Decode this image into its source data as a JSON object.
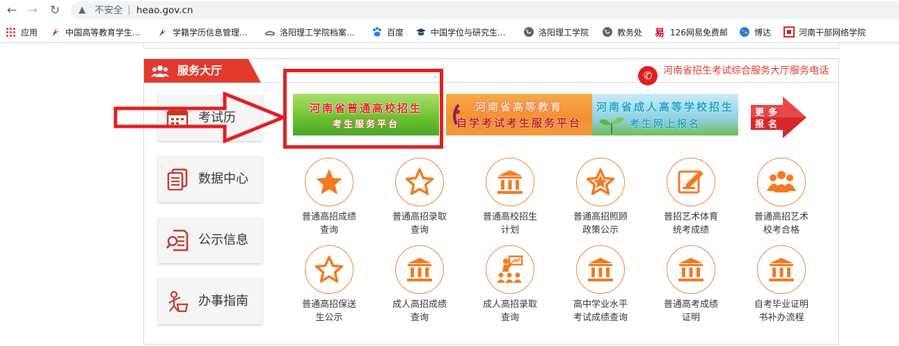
{
  "browser": {
    "insecure_label": "不安全",
    "url": "heao.gov.cn",
    "bookmarks": [
      {
        "label": "应用",
        "icon": "apps-grid-icon"
      },
      {
        "label": "中国高等教育学生...",
        "icon": "chsi-logo-icon"
      },
      {
        "label": "学籍学历信息管理...",
        "icon": "chsi-logo-icon"
      },
      {
        "label": "洛阳理工学院档案...",
        "icon": "archive-logo-icon"
      },
      {
        "label": "百度",
        "icon": "baidu-paw-icon"
      },
      {
        "label": "中国学位与研究生...",
        "icon": "graduation-cap-icon"
      },
      {
        "label": "洛阳理工学院",
        "icon": "globe-icon"
      },
      {
        "label": "教务处",
        "icon": "globe-icon"
      },
      {
        "label": "126网易免费邮",
        "icon": "netease-mail-icon"
      },
      {
        "label": "博达",
        "icon": "globe-color-icon"
      },
      {
        "label": "河南干部网络学院",
        "icon": "henan-cadre-logo-icon"
      }
    ]
  },
  "panel": {
    "title": "服务大厅",
    "hotline": "河南省招生考试综合服务大厅服务电话"
  },
  "side_menu": [
    {
      "label": "考试历",
      "icon": "calendar-icon"
    },
    {
      "label": "数据中心",
      "icon": "documents-icon"
    },
    {
      "label": "公示信息",
      "icon": "document-search-icon"
    },
    {
      "label": "办事指南",
      "icon": "guide-person-icon"
    }
  ],
  "banners": [
    {
      "line1": "河南省普通高校招生",
      "line2": "考生服务平台"
    },
    {
      "line1": "河南省高等教育",
      "line2": "自学考试考生服务平台"
    },
    {
      "line1": "河南省成人高等学校招生",
      "line2": "考生网上报名"
    }
  ],
  "more_button": {
    "line1": "更多",
    "line2": "报名"
  },
  "services": [
    {
      "line1": "普通高招成绩",
      "line2": "查询",
      "icon": "star-filled-icon"
    },
    {
      "line1": "普通高招录取",
      "line2": "查询",
      "icon": "star-outline-icon"
    },
    {
      "line1": "普通高校招生",
      "line2": "计划",
      "icon": "institution-icon"
    },
    {
      "line1": "普通高招照顾",
      "line2": "政策公示",
      "icon": "star-outline-icon"
    },
    {
      "line1": "普招艺术体育",
      "line2": "统考成绩",
      "icon": "edit-document-icon"
    },
    {
      "line1": "普通高招艺术",
      "line2": "校考合格",
      "icon": "group-icon"
    },
    {
      "line1": "普通高招保送",
      "line2": "生公示",
      "icon": "star-outline-icon"
    },
    {
      "line1": "成人高招成绩",
      "line2": "查询",
      "icon": "institution-icon"
    },
    {
      "line1": "成人高招录取",
      "line2": "查询",
      "icon": "presentation-icon"
    },
    {
      "line1": "高中学业水平",
      "line2": "考试成绩查询",
      "icon": "institution-icon"
    },
    {
      "line1": "普通高考成绩",
      "line2": "证明",
      "icon": "institution-icon"
    },
    {
      "line1": "自考毕业证明",
      "line2": "书补办流程",
      "icon": "institution-icon"
    }
  ],
  "colors": {
    "accent_red": "#e23a2c",
    "icon_orange": "#f0803b",
    "annotation_red": "#e02020"
  }
}
